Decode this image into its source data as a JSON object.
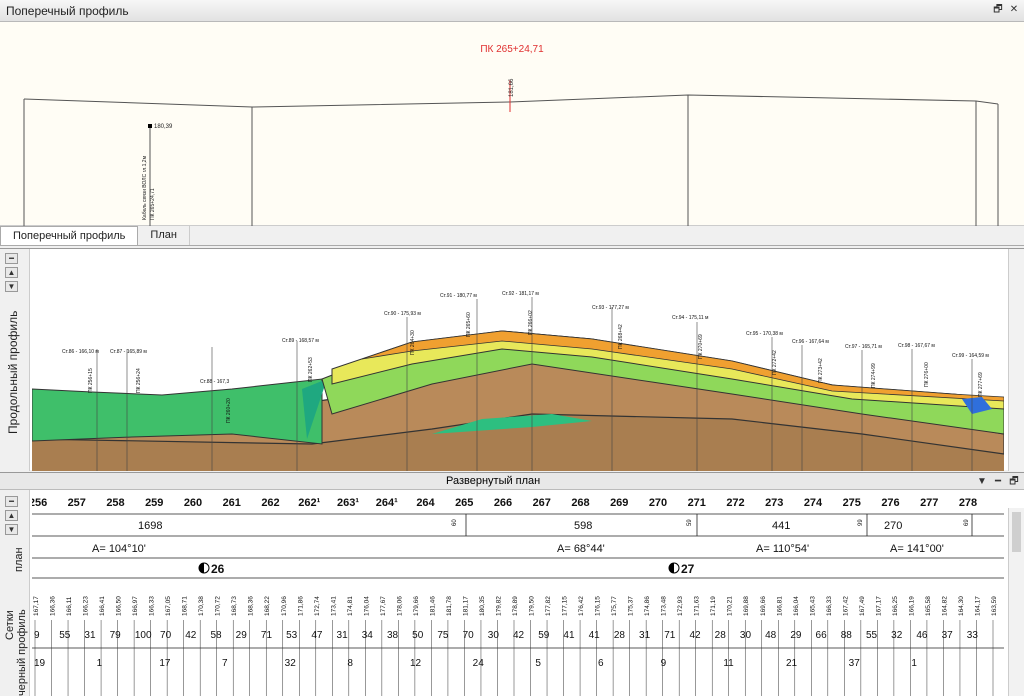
{
  "window": {
    "title": "Поперечный профиль"
  },
  "cross_section": {
    "pk_label": "ПК 265+24,71",
    "center_elev": "181,66",
    "left_elev": "180,39",
    "left_note": "Кабель связи ВОЛС гл.1,2м",
    "left_pk": "ПК 265+24,71"
  },
  "tabs": [
    {
      "label": "Поперечный профиль"
    },
    {
      "label": "План"
    }
  ],
  "profile": {
    "side_label": "Продольный профиль",
    "labels": [
      {
        "text": "Ст.86 - 166,10 м",
        "pk": "ПК 256+15"
      },
      {
        "text": "Ст.87 - 165,89 м",
        "pk": "ПК 256+24"
      },
      {
        "text": "Ст.88 - 167,3",
        "pk": "ПК 260+20"
      },
      {
        "text": "Ст.89 - 168,57 м",
        "pk": "ПК 262+53"
      },
      {
        "text": "Ст.90 - 175,93 м",
        "pk": "ПК 264+30"
      },
      {
        "text": "Ст.91 - 180,77 м",
        "pk": "ПК 265+60"
      },
      {
        "text": "Ст.92 - 181,17 м",
        "pk": "ПК 266+02"
      },
      {
        "text": "Ст.93 - 177,27 м",
        "pk": "ПК 268+42"
      },
      {
        "text": "Ст.94 - 175,11 м",
        "pk": "ПК 270+69"
      },
      {
        "text": "Ст.95 - 170,38 м",
        "pk": "ПК 272+42"
      },
      {
        "text": "Ст.96 - 167,64 м",
        "pk": "ПК 273+42"
      },
      {
        "text": "Ст.97 - 165,71 м",
        "pk": "ПК 274+99"
      },
      {
        "text": "Ст.98 - 167,67 м",
        "pk": "ПК 276+00"
      },
      {
        "text": "Ст.99 - 164,59 м",
        "pk": "ПК 277+69"
      }
    ]
  },
  "plan": {
    "header": "Развернутый план",
    "pickets": [
      "256",
      "257",
      "258",
      "259",
      "260",
      "261",
      "262",
      "262¹",
      "263¹",
      "264¹",
      "264",
      "265",
      "266",
      "267",
      "268",
      "269",
      "270",
      "271",
      "272",
      "273",
      "274",
      "275",
      "276",
      "277",
      "278"
    ],
    "plan_label": "план",
    "segments": [
      {
        "length": "1698",
        "angle": "A= 104°10'"
      },
      {
        "length": "598",
        "angle": "A= 68°44'"
      },
      {
        "length": "441",
        "angle": "A= 110°54'"
      },
      {
        "length": "270",
        "angle": "A= 141°00'"
      }
    ],
    "small_marks": [
      "60",
      "59",
      "99",
      "69"
    ],
    "vertices": [
      "26",
      "27"
    ],
    "grid_labels": [
      "Сетки",
      "черный профиль"
    ],
    "elevations": [
      "167,17",
      "166,36",
      "166,11",
      "166,23",
      "166,41",
      "166,50",
      "166,97",
      "166,33",
      "167,05",
      "168,71",
      "170,38",
      "170,72",
      "168,73",
      "168,36",
      "168,22",
      "170,96",
      "171,86",
      "172,74",
      "173,41",
      "174,81",
      "176,04",
      "177,67",
      "178,06",
      "179,66",
      "181,46",
      "181,78",
      "181,17",
      "180,35",
      "179,82",
      "178,89",
      "179,50",
      "177,82",
      "177,15",
      "176,42",
      "176,15",
      "175,77",
      "175,37",
      "174,86",
      "173,48",
      "172,93",
      "171,63",
      "171,19",
      "170,21",
      "169,88",
      "169,66",
      "166,81",
      "166,04",
      "165,43",
      "166,33",
      "167,42",
      "167,49",
      "167,17",
      "166,25",
      "166,19",
      "165,58",
      "164,82",
      "164,30",
      "164,17",
      "163,59"
    ],
    "distances_row1": [
      "9",
      "55",
      "31",
      "79",
      "100",
      "70",
      "42",
      "58",
      "29",
      "71",
      "53",
      "47",
      "31",
      "34",
      "38",
      "50",
      "75",
      "70",
      "30",
      "42",
      "59",
      "41",
      "41",
      "28",
      "31",
      "71",
      "42",
      "28",
      "30",
      "48",
      "29",
      "66",
      "88",
      "55",
      "32",
      "46",
      "37",
      "33"
    ],
    "distances_row2": [
      "19",
      "1",
      "17",
      "7",
      "32",
      "8",
      "12",
      "24",
      "5",
      "6",
      "9",
      "11",
      "21",
      "37",
      "1"
    ]
  },
  "colors": {
    "tan": "#b98a5a",
    "green": "#3fbf6a",
    "dark_green": "#1f9e4f",
    "yellow": "#e8e85a",
    "orange": "#f0a030",
    "light_green": "#8fd85a"
  }
}
